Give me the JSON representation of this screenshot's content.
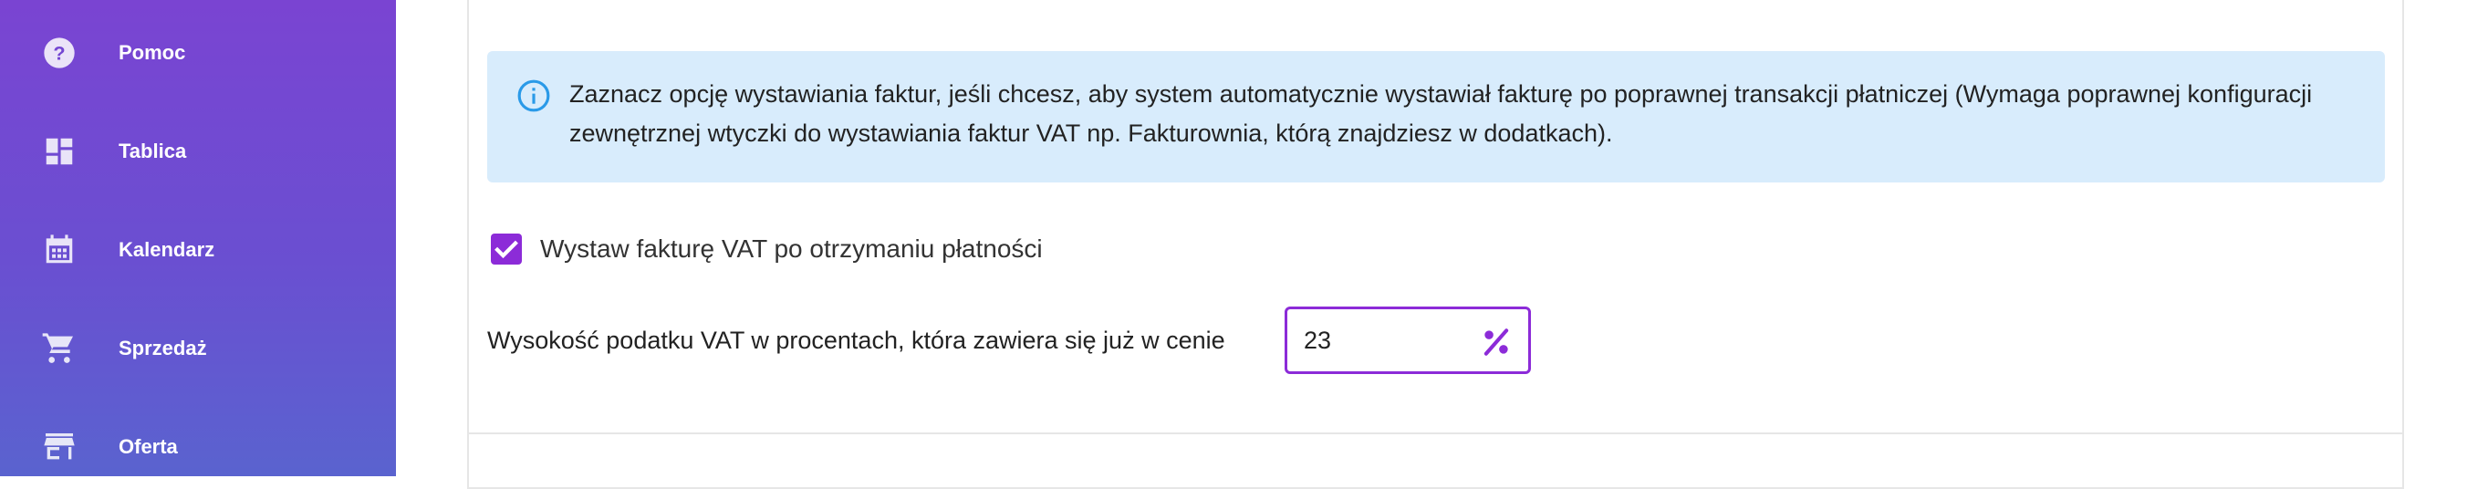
{
  "sidebar": {
    "items": [
      {
        "label": "Pomoc",
        "icon": "help-icon"
      },
      {
        "label": "Tablica",
        "icon": "dashboard-icon"
      },
      {
        "label": "Kalendarz",
        "icon": "calendar-icon"
      },
      {
        "label": "Sprzedaż",
        "icon": "cart-icon"
      },
      {
        "label": "Oferta",
        "icon": "store-icon"
      }
    ]
  },
  "info": {
    "text": "Zaznacz opcję wystawiania faktur, jeśli chcesz, aby system automatycznie wystawiał fakturę po poprawnej transakcji płatniczej (Wymaga poprawnej konfiguracji zewnętrznej wtyczki do wystawiania faktur VAT np. Fakturownia, którą znajdziesz w dodatkach).",
    "icon": "info-icon"
  },
  "invoice": {
    "checkbox_label": "Wystaw fakturę VAT po otrzymaniu płatności",
    "checked": true
  },
  "vat": {
    "label": "Wysokość podatku VAT w procentach, która zawiera się już w cenie",
    "value": "23",
    "suffix_icon": "percent-icon"
  },
  "colors": {
    "sidebar_gradient_top": "#7a44d2",
    "sidebar_gradient_bottom": "#5a63cf",
    "accent": "#8c2bd8",
    "info_background": "#d8ecfc",
    "info_icon": "#2a9ae8"
  }
}
